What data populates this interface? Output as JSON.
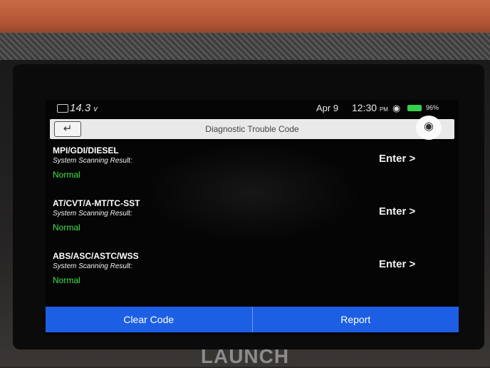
{
  "status_bar": {
    "voltage": "14.3",
    "voltage_unit": "v",
    "date": "Apr 9",
    "time": "12:30",
    "time_ampm": "PM",
    "battery_percent": "96%",
    "icons": [
      "car-battery-icon",
      "wifi-icon",
      "battery-icon"
    ]
  },
  "title_bar": {
    "back_icon": "back-arrow-icon",
    "title": "Diagnostic Trouble Code",
    "screenshot_icon": "camera-icon"
  },
  "systems": [
    {
      "name": "MPI/GDI/DIESEL",
      "result_label": "System Scanning Result:",
      "status": "Normal",
      "action": "Enter >"
    },
    {
      "name": "AT/CVT/A-MT/TC-SST",
      "result_label": "System Scanning Result:",
      "status": "Normal",
      "action": "Enter >"
    },
    {
      "name": "ABS/ASC/ASTC/WSS",
      "result_label": "System Scanning Result:",
      "status": "Normal",
      "action": "Enter >"
    }
  ],
  "bottom_bar": {
    "clear_code": "Clear Code",
    "report": "Report"
  },
  "device": {
    "brand": "LAUNCH"
  },
  "colors": {
    "accent": "#1d5fe4",
    "status_ok": "#3ee64a",
    "device_orange": "#b25434"
  }
}
